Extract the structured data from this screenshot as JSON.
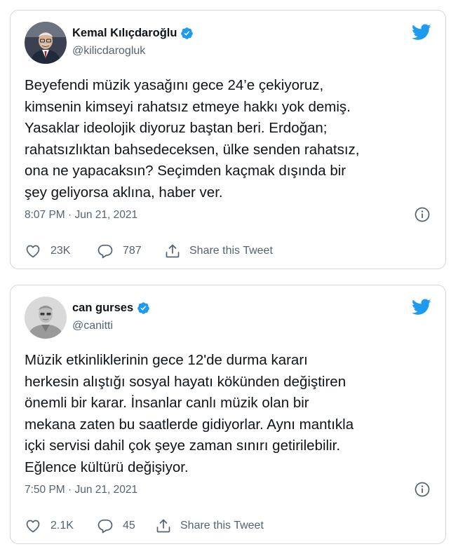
{
  "colors": {
    "brand": "#1d9bf0",
    "text_primary": "#0f1419",
    "text_secondary": "#536471",
    "border": "#cfd9de"
  },
  "icons": [
    "avatar",
    "verified-badge-icon",
    "twitter-bird-icon",
    "info-icon",
    "heart-icon",
    "reply-bubble-icon",
    "share-icon"
  ],
  "tweets": [
    {
      "display_name": "Kemal Kılıçdaroğlu",
      "handle": "@kilicdarogluk",
      "verified": true,
      "lines": [
        "Beyefendi müzik yasağını gece 24’e çekiyoruz,",
        "kimsenin kimseyi rahatsız etmeye hakkı yok demiş.",
        "Yasaklar ideolojik diyoruz baştan beri. Erdoğan;",
        "rahatsızlıktan bahsedeceksen, ülke senden rahatsız,",
        "ona ne yapacaksın? Seçimden kaçmak dışında bir",
        "şey geliyorsa aklına, haber ver."
      ],
      "timestamp": "8:07 PM · Jun 21, 2021",
      "likes": "23K",
      "replies": "787",
      "share_label": "Share this Tweet"
    },
    {
      "display_name": "can gurses",
      "handle": "@canitti",
      "verified": true,
      "lines": [
        "Müzik etkinliklerinin gece 12'de durma kararı",
        "herkesin alıştığı sosyal hayatı kökünden değiştiren",
        "önemli bir karar. İnsanlar canlı müzik olan bir",
        "mekana zaten bu saatlerde gidiyorlar. Aynı mantıkla",
        "içki servisi dahil çok şeye zaman sınırı getirilebilir.",
        "Eğlence kültürü değişiyor."
      ],
      "timestamp": "7:50 PM · Jun 21, 2021",
      "likes": "2.1K",
      "replies": "45",
      "share_label": "Share this Tweet"
    }
  ]
}
